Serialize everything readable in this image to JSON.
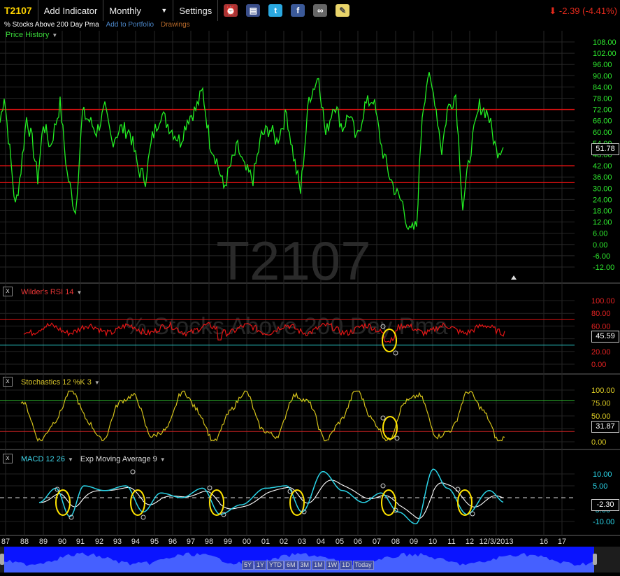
{
  "toolbar": {
    "ticker": "T2107",
    "add_indicator": "Add Indicator",
    "period": "Monthly",
    "settings": "Settings",
    "change": "-2.39 (-4.41%)"
  },
  "subbar": {
    "title": "% Stocks Above 200 Day Pma",
    "add_portfolio": "Add to Portfolio",
    "drawings": "Drawings"
  },
  "price_panel": {
    "label": "Price History",
    "watermark": "T2107",
    "last_value": "51.78",
    "axis": [
      "108.00",
      "102.00",
      "96.00",
      "90.00",
      "84.00",
      "78.00",
      "72.00",
      "66.00",
      "60.00",
      "54.00",
      "48.00",
      "42.00",
      "36.00",
      "30.00",
      "24.00",
      "18.00",
      "12.00",
      "6.00",
      "0.00",
      "-6.00",
      "-12.00"
    ],
    "levels": [
      72,
      42,
      33
    ]
  },
  "rsi_panel": {
    "label": "Wilder's RSI 14",
    "watermark": "% Stocks Above 200 Day Pma",
    "last_value": "45.59",
    "axis": [
      "100.00",
      "80.00",
      "60.00",
      "40.00",
      "20.00",
      "0.00"
    ]
  },
  "stoch_panel": {
    "label": "Stochastics 12 %K 3",
    "last_value": "31.87",
    "axis": [
      "100.00",
      "75.00",
      "50.00",
      "25.00",
      "0.00"
    ]
  },
  "macd_panel": {
    "label": "MACD 12 26",
    "label2": "Exp Moving Average 9",
    "last_value": "-2.30",
    "axis": [
      "10.00",
      "5.00",
      "-5.00",
      "-10.00"
    ]
  },
  "xaxis": [
    "87",
    "88",
    "89",
    "90",
    "91",
    "92",
    "93",
    "94",
    "95",
    "96",
    "97",
    "98",
    "99",
    "00",
    "01",
    "02",
    "03",
    "04",
    "05",
    "06",
    "07",
    "08",
    "09",
    "10",
    "11",
    "12",
    "12/3/2013",
    "16",
    "17"
  ],
  "range_buttons": [
    "5Y",
    "1Y",
    "YTD",
    "6M",
    "3M",
    "1M",
    "1W",
    "1D",
    "Today"
  ],
  "colors": {
    "price": "#22ee22",
    "rsi": "#e51515",
    "stoch": "#d4c21a",
    "macd": "#2ad3e6",
    "macd_signal": "#ffffff",
    "level": "#d11",
    "highlight": "#ffe400"
  }
}
